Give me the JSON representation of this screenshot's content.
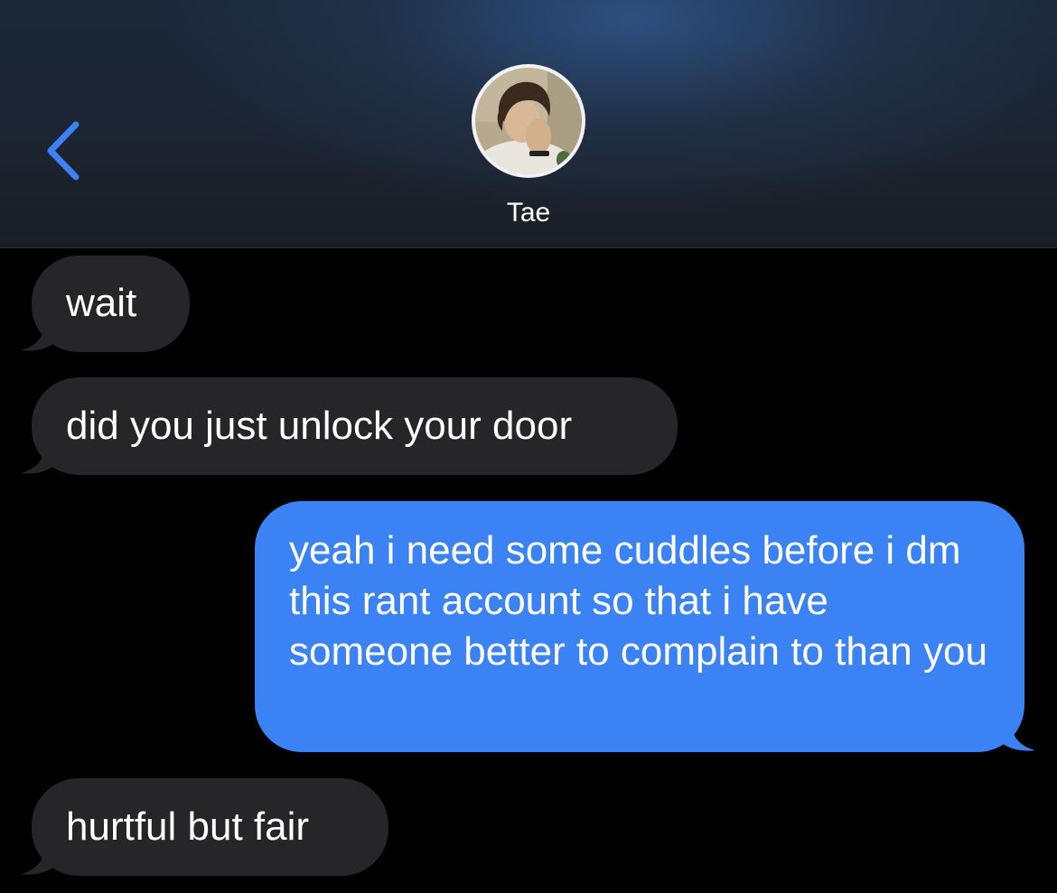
{
  "header": {
    "back_icon": "chevron-left-icon",
    "contact_name": "Tae",
    "accent_color": "#3b82f5"
  },
  "messages": [
    {
      "direction": "incoming",
      "text": "wait"
    },
    {
      "direction": "incoming",
      "text": "did you just unlock your door"
    },
    {
      "direction": "outgoing",
      "text": "yeah i need some cuddles before i dm this rant account so that i have someone better to complain to than you"
    },
    {
      "direction": "incoming",
      "text": "hurtful but fair"
    }
  ],
  "colors": {
    "incoming_bubble": "#262628",
    "outgoing_bubble": "#3b82f5",
    "background": "#000000"
  }
}
